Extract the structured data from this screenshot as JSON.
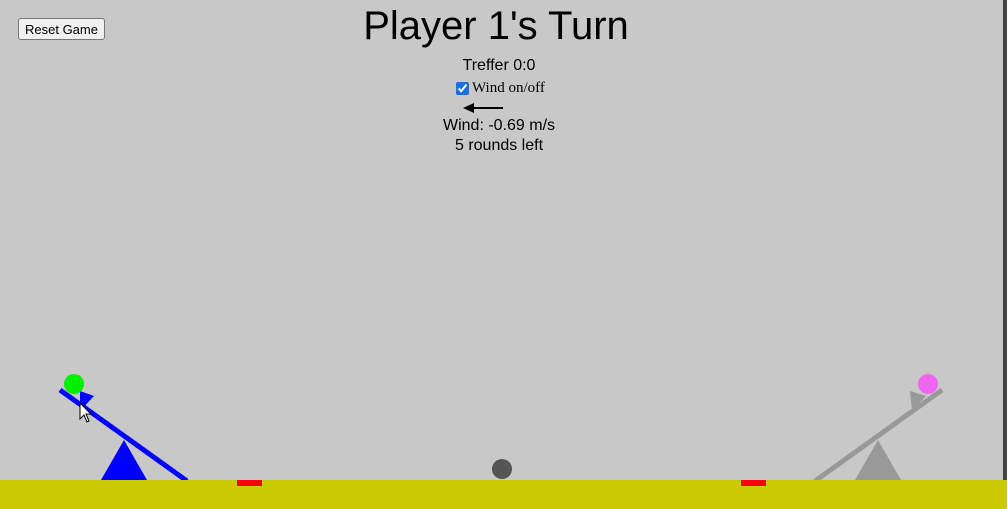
{
  "controls": {
    "reset_label": "Reset Game"
  },
  "status": {
    "turn_title": "Player 1's Turn",
    "score": "Treffer 0:0",
    "wind_toggle_label": "Wind on/off",
    "wind_enabled": true,
    "wind_text": "Wind: -0.69 m/s",
    "rounds_text": "5 rounds left"
  },
  "colors": {
    "background": "#c8c8c8",
    "ground": "#cbc900",
    "player1": "#0000ff",
    "player1_ball": "#00ee00",
    "player2": "#999999",
    "player2_ball": "#ee66ee",
    "target": "#ff0000",
    "obstacle": "#555555"
  }
}
